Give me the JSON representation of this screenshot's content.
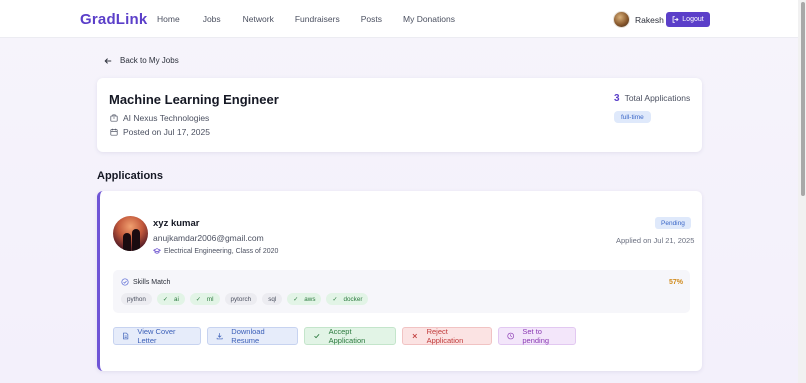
{
  "navbar": {
    "brand": "GradLink",
    "links": [
      "Home",
      "Jobs",
      "Network",
      "Fundraisers",
      "Posts",
      "My Donations"
    ],
    "user_name": "Rakesh",
    "logout_label": "Logout"
  },
  "back_link": "Back to My Jobs",
  "job": {
    "title": "Machine Learning Engineer",
    "company": "AI Nexus Technologies",
    "posted": "Posted on Jul 17, 2025",
    "applications_count": "3",
    "applications_label": "Total Applications",
    "type": "full-time"
  },
  "applications_heading": "Applications",
  "applicant": {
    "name": "xyz kumar",
    "email": "anujkamdar2006@gmail.com",
    "education": "Electrical Engineering, Class of 2020",
    "status": "Pending",
    "applied_on": "Applied on Jul 21, 2025",
    "skills_title": "Skills Match",
    "match_percent": "57%",
    "skills": [
      {
        "name": "python",
        "matched": false
      },
      {
        "name": "ai",
        "matched": true
      },
      {
        "name": "ml",
        "matched": true
      },
      {
        "name": "pytorch",
        "matched": false
      },
      {
        "name": "sql",
        "matched": false
      },
      {
        "name": "aws",
        "matched": true
      },
      {
        "name": "docker",
        "matched": true
      }
    ]
  },
  "actions": {
    "cover_letter": "View Cover Letter",
    "resume": "Download Resume",
    "accept": "Accept Application",
    "reject": "Reject Application",
    "pending": "Set to pending"
  },
  "colors": {
    "brand": "#5b3fc9",
    "accept": "#2b7a3e",
    "reject": "#c03a3a",
    "pending": "#8b3ab4",
    "match_percent": "#d08a1a"
  }
}
